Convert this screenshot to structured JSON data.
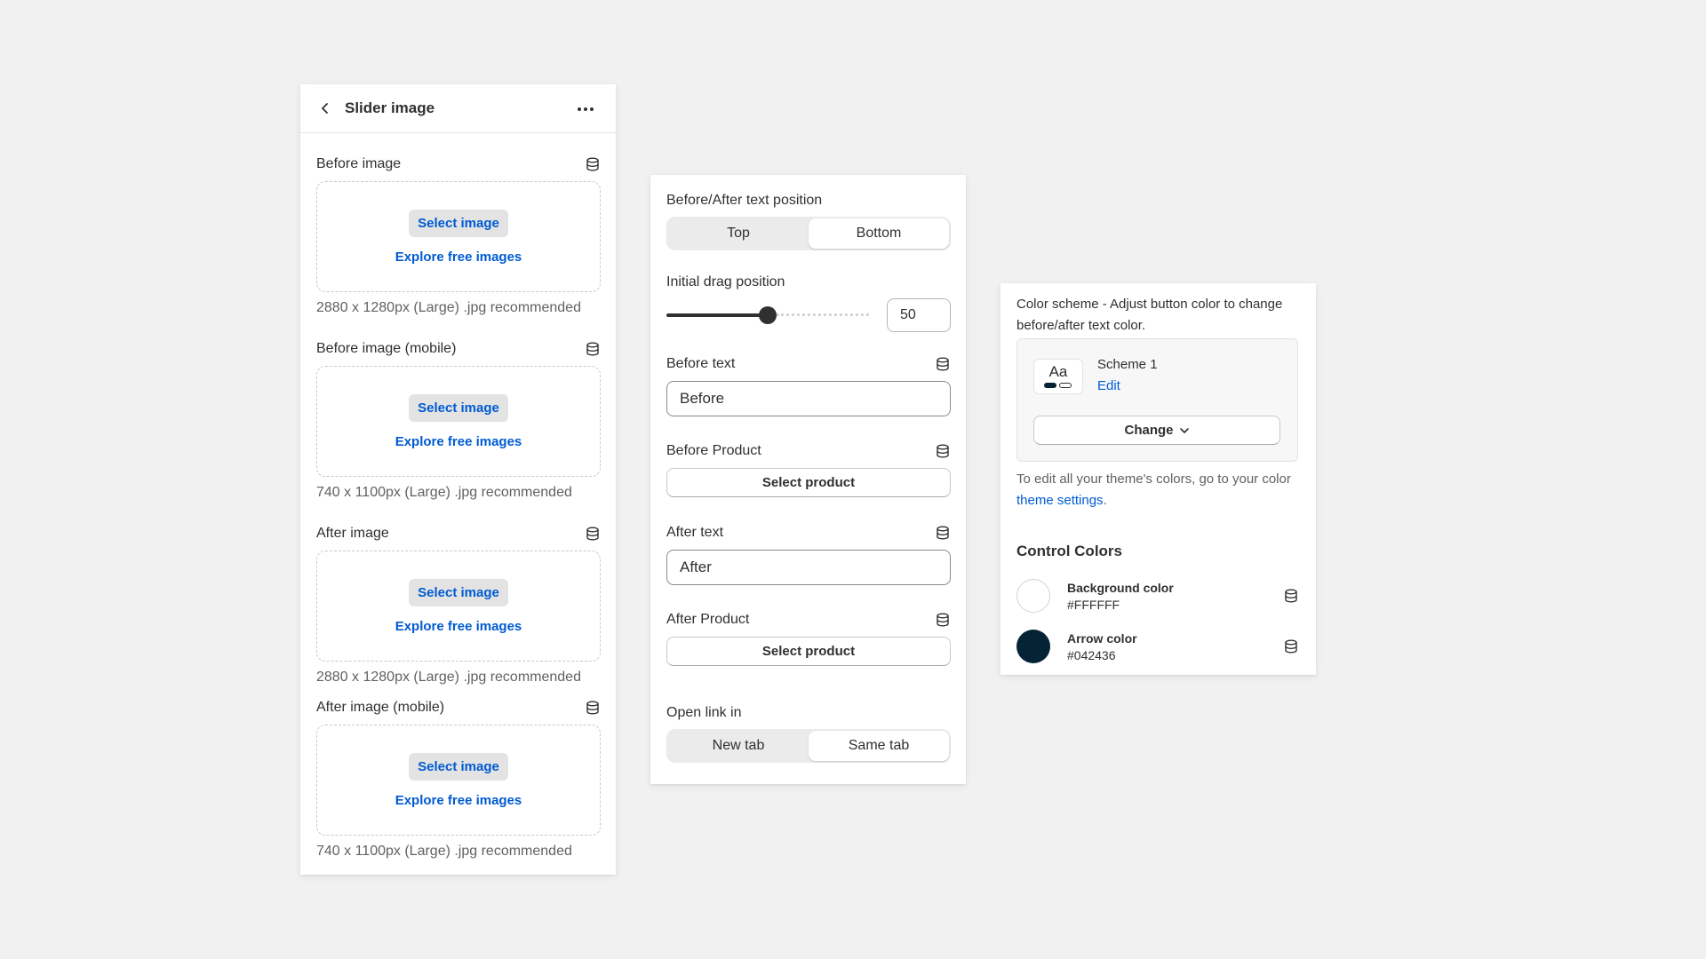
{
  "slider_panel": {
    "title": "Slider image",
    "sections": [
      {
        "label": "Before image",
        "select_label": "Select image",
        "explore_label": "Explore free images",
        "hint": "2880 x 1280px (Large) .jpg recommended"
      },
      {
        "label": "Before image (mobile)",
        "select_label": "Select image",
        "explore_label": "Explore free images",
        "hint": "740 x 1100px (Large) .jpg recommended"
      },
      {
        "label": "After image",
        "select_label": "Select image",
        "explore_label": "Explore free images",
        "hint": "2880 x 1280px (Large) .jpg recommended"
      },
      {
        "label": "After image (mobile)",
        "select_label": "Select image",
        "explore_label": "Explore free images",
        "hint": "740 x 1100px (Large) .jpg recommended"
      }
    ]
  },
  "settings_panel": {
    "text_position": {
      "label": "Before/After text position",
      "options": [
        "Top",
        "Bottom"
      ],
      "selected": "Bottom"
    },
    "drag_position": {
      "label": "Initial drag position",
      "value": "50",
      "fraction": 0.5
    },
    "before_text": {
      "label": "Before text",
      "value": "Before"
    },
    "before_product": {
      "label": "Before Product",
      "button": "Select product"
    },
    "after_text": {
      "label": "After text",
      "value": "After"
    },
    "after_product": {
      "label": "After Product",
      "button": "Select product"
    },
    "open_link": {
      "label": "Open link in",
      "options": [
        "New tab",
        "Same tab"
      ],
      "selected": "Same tab"
    }
  },
  "colors_panel": {
    "description": "Color scheme - Adjust button color to change before/after text color.",
    "scheme": {
      "thumb_text": "Aa",
      "name": "Scheme 1",
      "edit_label": "Edit",
      "change_label": "Change"
    },
    "theme_note_prefix": "To edit all your theme's colors, go to your color ",
    "theme_link": "theme settings",
    "theme_note_suffix": ".",
    "control_title": "Control Colors",
    "controls": [
      {
        "name": "Background color",
        "hex": "#FFFFFF"
      },
      {
        "name": "Arrow color",
        "hex": "#042436"
      }
    ]
  },
  "colors": {
    "accent": "#005bd3",
    "text": "#303030",
    "arrow": "#042436"
  }
}
